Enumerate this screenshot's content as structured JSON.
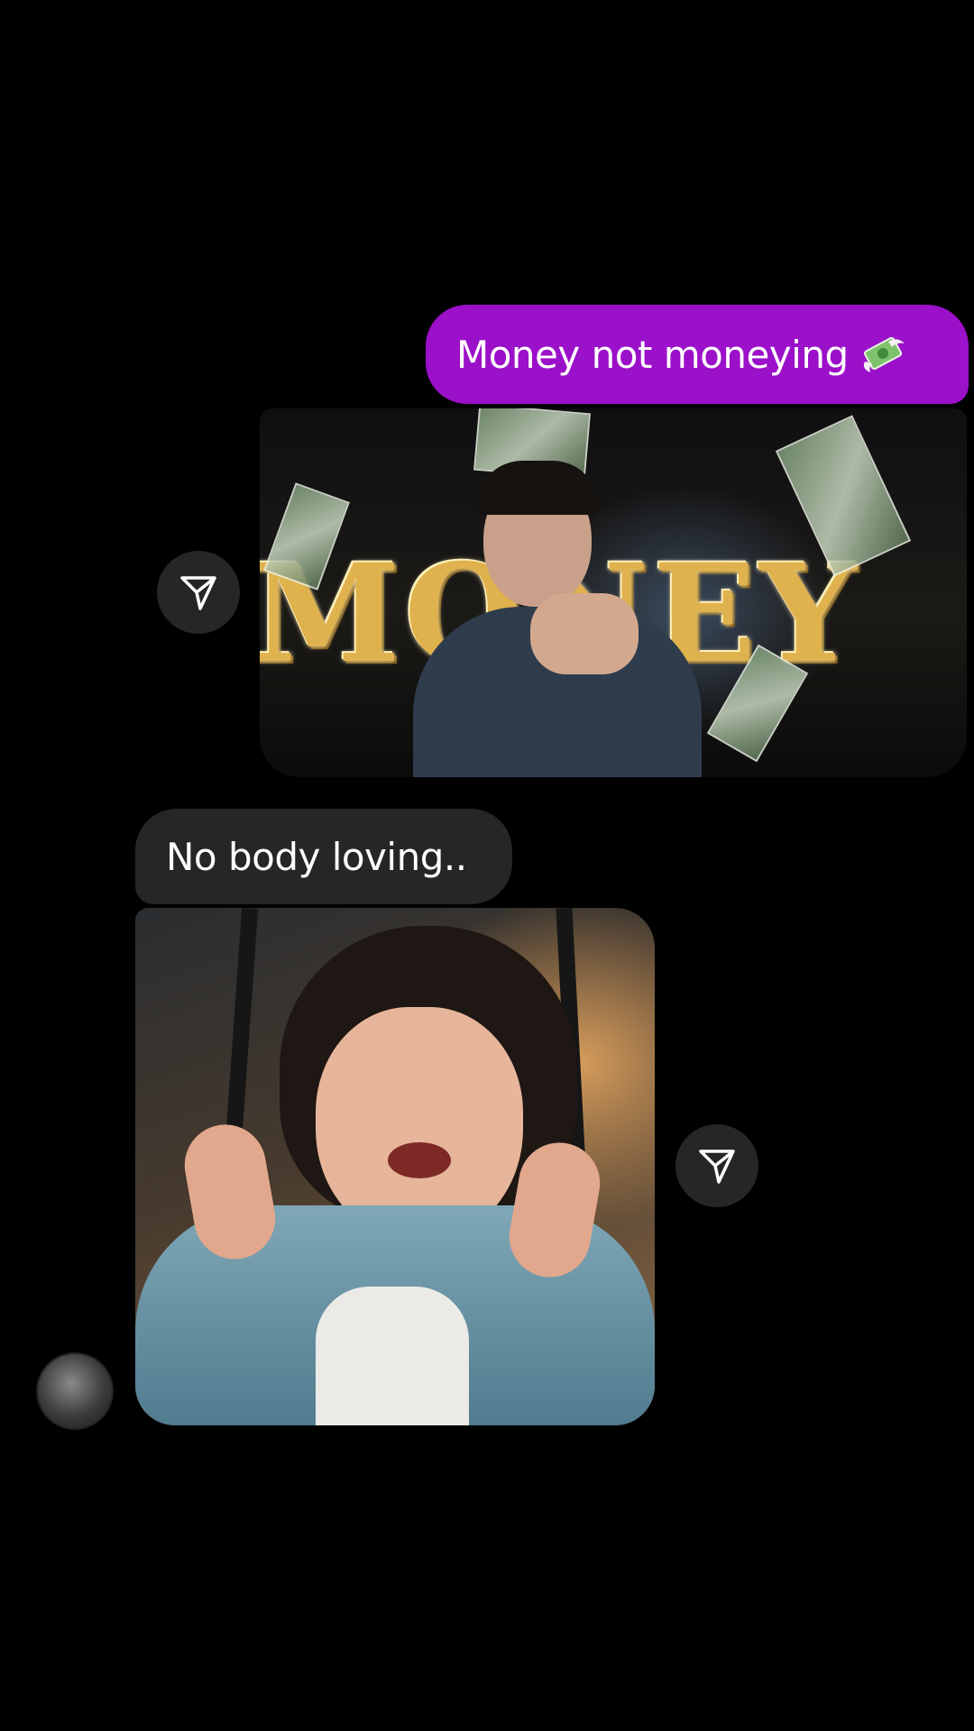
{
  "chat": {
    "messages": [
      {
        "sender": "me",
        "type": "text",
        "text": "Money not moneying",
        "emoji": "money-with-wings-icon"
      },
      {
        "sender": "me",
        "type": "gif",
        "image_text": "MONEY"
      },
      {
        "sender": "them",
        "type": "text",
        "text": "No body loving.."
      },
      {
        "sender": "them",
        "type": "gif"
      }
    ]
  },
  "colors": {
    "sent_bubble": "#9b10c9",
    "received_bubble": "#262626",
    "background": "#000000"
  }
}
